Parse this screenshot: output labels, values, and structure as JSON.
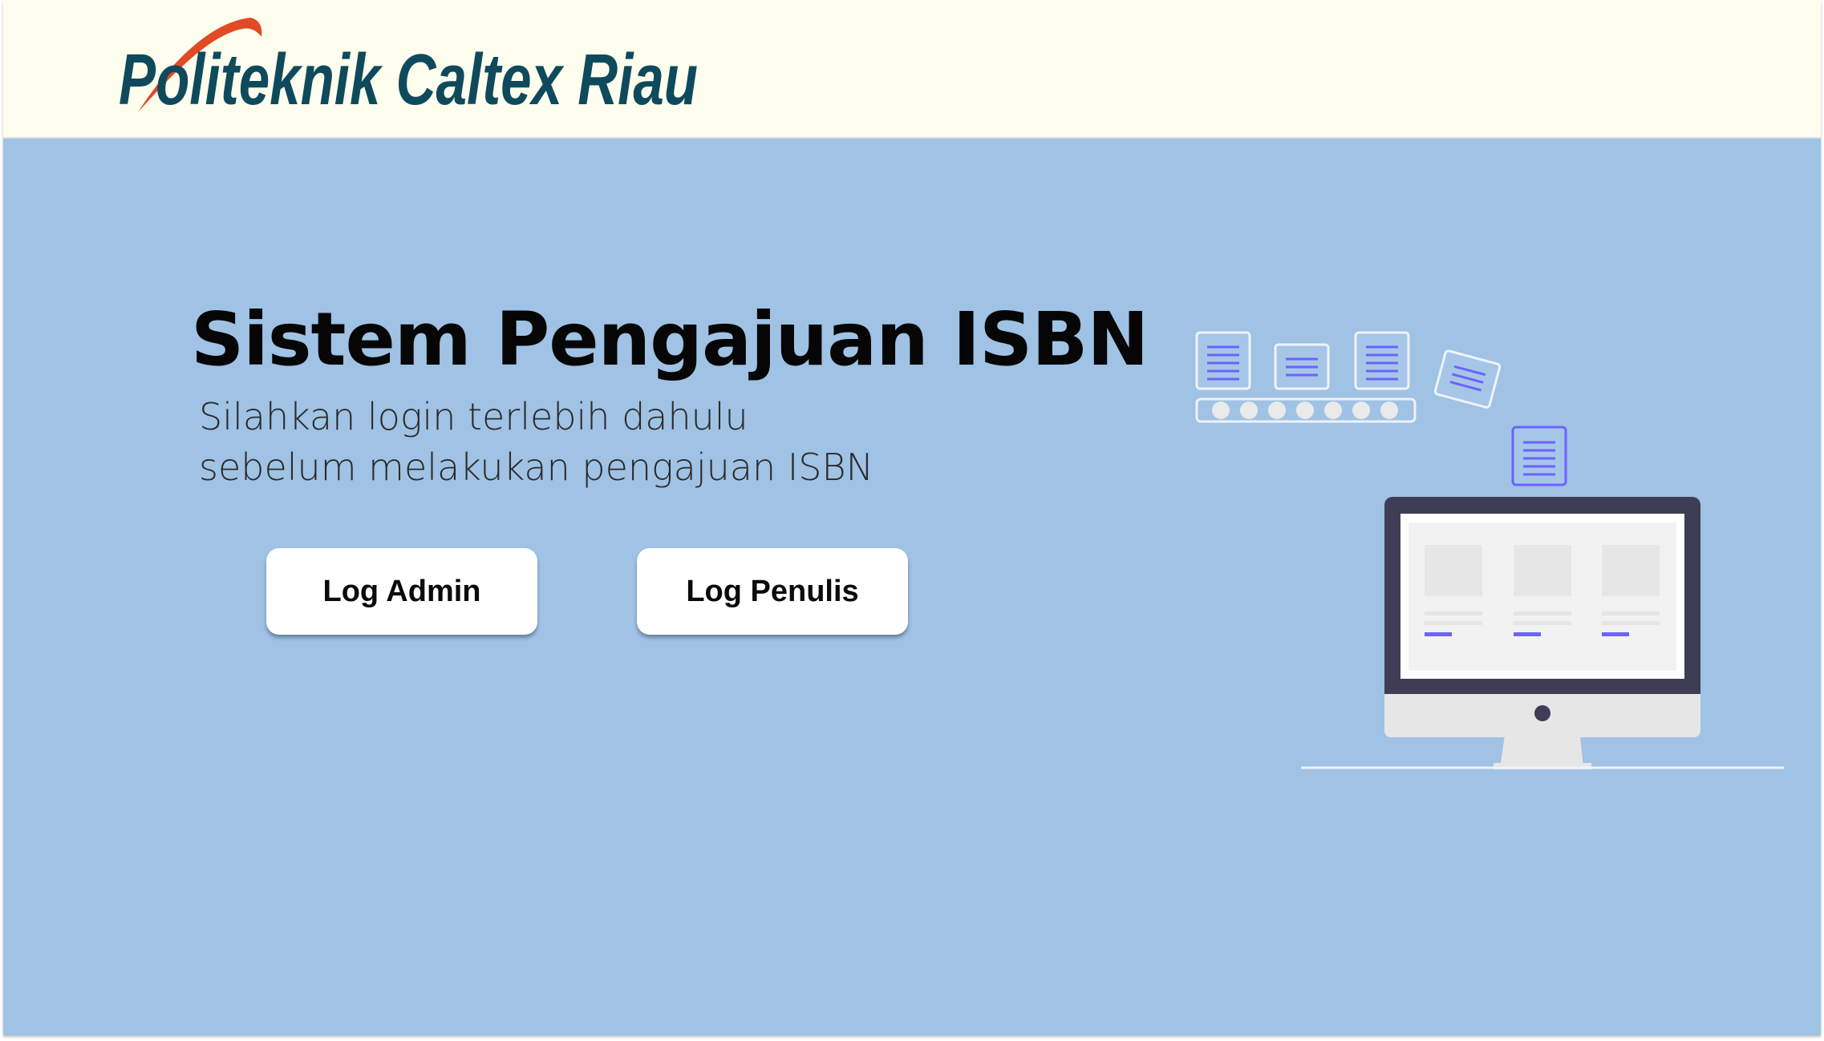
{
  "header": {
    "logo_text": "Politeknik Caltex Riau"
  },
  "hero": {
    "title": "Sistem Pengajuan ISBN",
    "subtitle_line1": "Silahkan login terlebih dahulu",
    "subtitle_line2": "sebelum melakukan pengajuan ISBN",
    "admin_button_label": "Log Admin",
    "penulis_button_label": "Log Penulis"
  },
  "colors": {
    "header_bg": "#fefeee",
    "hero_bg": "#a0c2e4",
    "logo_text": "#0f4a5c",
    "logo_swoosh": "#e04a25",
    "accent_lines": "#6c63ff",
    "monitor_frame": "#3f3d56"
  },
  "illustration": {
    "icon": "computer-upload-illustration"
  }
}
